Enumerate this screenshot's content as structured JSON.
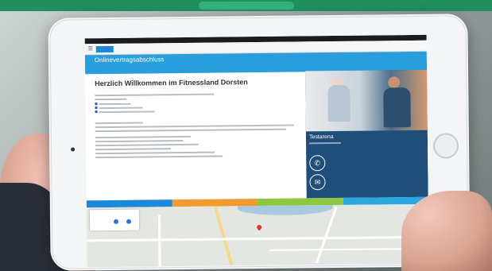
{
  "page": {
    "title": "Onlinevertragsabschluss",
    "heading": "Herzlich Willkommen im Fitnessland Dorsten",
    "sidebar_title": "Testarena",
    "colors": {
      "banner": "#2a9ddd",
      "sidebar": "#1f4e7a",
      "tab_blue": "#1e88d8",
      "tab_orange": "#f29a2e",
      "tab_green": "#8dc63f",
      "tab_lightblue": "#2aa7e0",
      "logo": "#1e88d8"
    },
    "icons": [
      "phone-icon",
      "mail-icon",
      "map-pin-icon",
      "menu-icon"
    ]
  }
}
